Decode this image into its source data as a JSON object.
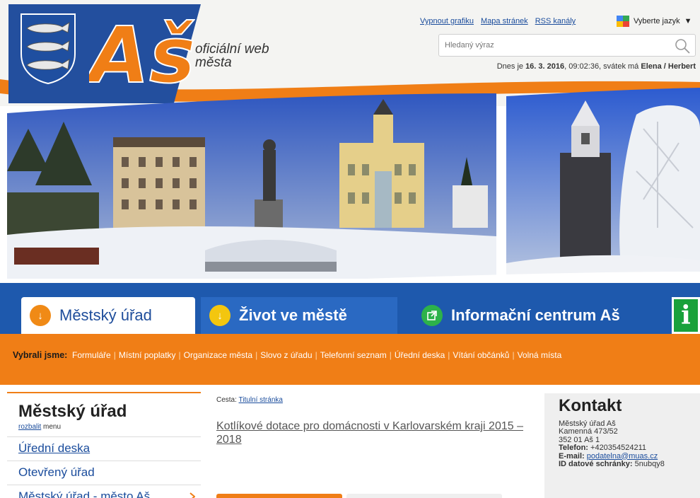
{
  "header": {
    "logo_text": "Aš",
    "tagline_line1": "oficiální web",
    "tagline_line2": "města",
    "top_links": [
      "Vypnout grafiku",
      "Mapa stránek",
      "RSS kanály"
    ],
    "language_label": "Vyberte jazyk",
    "search_placeholder": "Hledaný výraz",
    "date_prefix": "Dnes je",
    "date": "16. 3. 2016",
    "time": ", 09:02:36, svátek má",
    "names": "Elena / Herbert"
  },
  "tabs": [
    {
      "label": "Městský úřad",
      "icon": "arrow-down-icon"
    },
    {
      "label": "Život ve městě",
      "icon": "arrow-down-icon"
    },
    {
      "label": "Informační centrum Aš",
      "icon": "external-link-icon"
    }
  ],
  "info_button": "i",
  "quick": {
    "lead": "Vybrali jsme:",
    "items": [
      "Formuláře",
      "Místní poplatky",
      "Organizace města",
      "Slovo z úřadu",
      "Telefonní seznam",
      "Úřední deska",
      "Vítání občánků",
      "Volná místa"
    ]
  },
  "leftnav": {
    "title": "Městský úřad",
    "expand_link": "rozbalit",
    "expand_suffix": " menu",
    "items": [
      "Úřední deska",
      "Otevřený úřad",
      "Městský úřad - město Aš"
    ]
  },
  "center": {
    "crumb_label": "Cesta:",
    "crumb_link": "Titulní stránka",
    "headline": "Kotlíkové dotace pro domácnosti v Karlovarském kraji 2015 – 2018"
  },
  "contact": {
    "title": "Kontakt",
    "line1": "Městský úřad Aš",
    "line2": "Kamenná 473/52",
    "line3": "352 01 Aš 1",
    "phone_label": "Telefon:",
    "phone": " +420354524211",
    "email_label": "E-mail:",
    "email": "podatelna@muas.cz",
    "ds_label": "ID datové schránky:",
    "ds": " 5nubqy8"
  },
  "colors": {
    "blue": "#1e59ad",
    "orange": "#f07e16",
    "green": "#19a13b"
  }
}
